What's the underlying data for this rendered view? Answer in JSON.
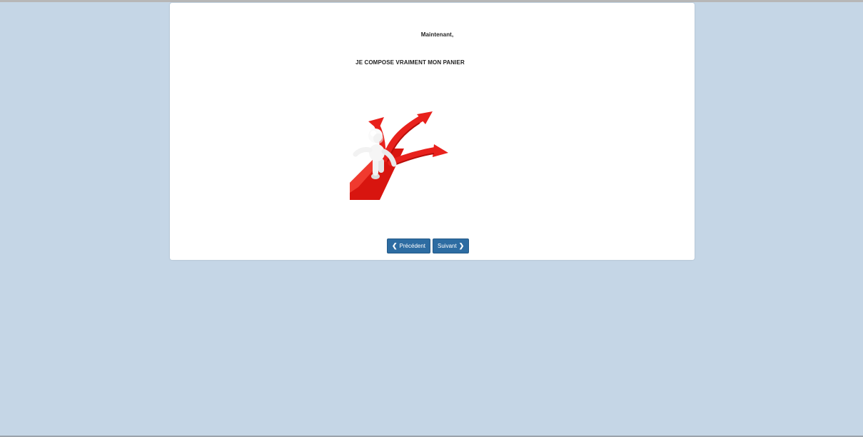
{
  "content": {
    "line1": "Maintenant,",
    "line2": "JE COMPOSE VRAIMENT MON PANIER"
  },
  "navigation": {
    "prev_label": "Précédent",
    "next_label": "Suivant",
    "prev_icon": "chevron-left-icon",
    "next_icon": "chevron-right-icon"
  },
  "colors": {
    "background": "#c5d6e6",
    "card": "#ffffff",
    "button": "#2d6ca2",
    "arrow_red": "#e8211c"
  },
  "illustration": {
    "icon": "figure-at-crossroads-arrows-icon"
  }
}
